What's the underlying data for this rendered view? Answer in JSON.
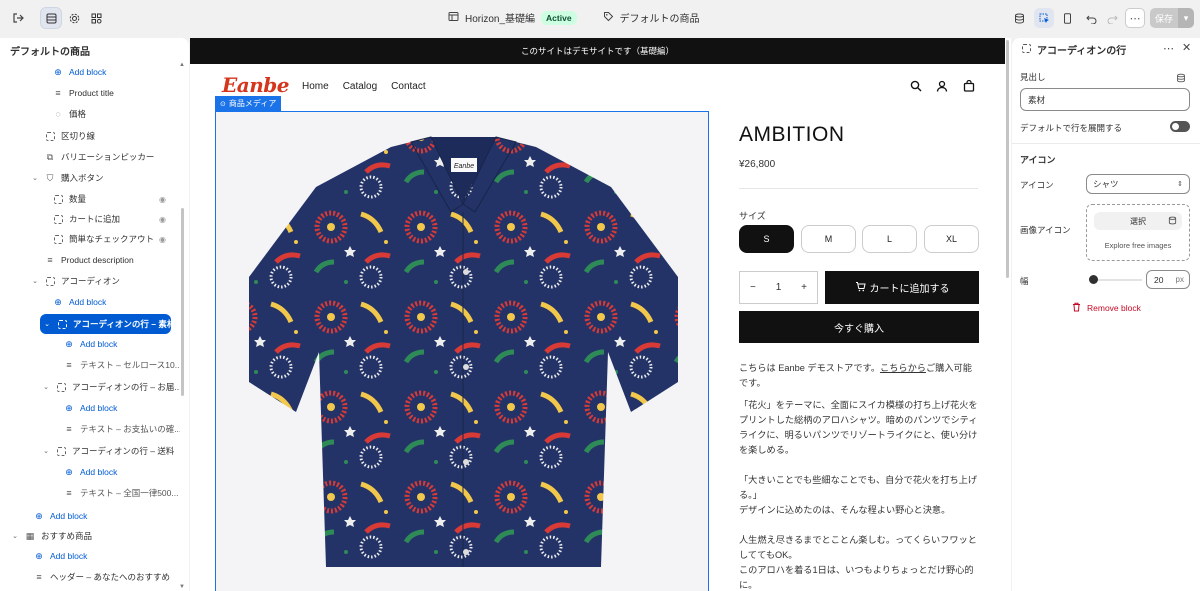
{
  "topbar": {
    "store_name": "Horizon_基礎編",
    "status": "Active",
    "template": "デフォルトの商品",
    "save": "保存"
  },
  "left": {
    "title": "デフォルトの商品",
    "rows": [
      {
        "label": "Add block",
        "type": "add"
      },
      {
        "label": "Product title",
        "type": "item"
      },
      {
        "label": "価格",
        "type": "item"
      },
      {
        "label": "区切り線",
        "type": "item"
      },
      {
        "label": "バリエーションピッカー",
        "type": "item"
      },
      {
        "label": "購入ボタン",
        "type": "group"
      },
      {
        "label": "数量",
        "type": "item"
      },
      {
        "label": "カートに追加",
        "type": "item"
      },
      {
        "label": "簡単なチェックアウト",
        "type": "item"
      },
      {
        "label": "Product description",
        "type": "item"
      },
      {
        "label": "アコーディオン",
        "type": "group"
      },
      {
        "label": "Add block",
        "type": "add"
      },
      {
        "label": "アコーディオンの行 – 素材",
        "type": "group"
      },
      {
        "label": "Add block",
        "type": "add"
      },
      {
        "label": "テキスト – セルロース10...",
        "type": "item"
      },
      {
        "label": "アコーディオンの行 – お届...",
        "type": "group"
      },
      {
        "label": "Add block",
        "type": "add"
      },
      {
        "label": "テキスト – お支払いの確...",
        "type": "item"
      },
      {
        "label": "アコーディオンの行 – 送料",
        "type": "group"
      },
      {
        "label": "Add block",
        "type": "add"
      },
      {
        "label": "テキスト – 全国一律500...",
        "type": "item"
      },
      {
        "label": "Add block",
        "type": "add"
      },
      {
        "label": "おすすめ商品",
        "type": "group"
      },
      {
        "label": "Add block",
        "type": "add"
      },
      {
        "label": "ヘッダー – あなたへのおすすめ",
        "type": "item"
      }
    ]
  },
  "preview": {
    "announcement": "このサイトはデモサイトです（基礎編）",
    "logo": "Eanbe",
    "nav": [
      "Home",
      "Catalog",
      "Contact"
    ],
    "media_tag": "商品メディア",
    "product_title": "AMBITION",
    "price": "¥26,800",
    "size_label": "サイズ",
    "sizes": [
      "S",
      "M",
      "L",
      "XL"
    ],
    "quantity": "1",
    "add_to_cart": "カートに追加する",
    "buy_now": "今すぐ購入",
    "desc_lead": "こちらは Eanbe デモストアです。",
    "desc_link": "こちらから",
    "desc_tail": "ご購入可能です。",
    "desc_p2": "「花火」をテーマに、全面にスイカ模様の打ち上げ花火をプリントした総柄のアロハシャツ。暗めのパンツでシティライクに、明るいパンツでリゾートライクにと、使い分けを楽しめる。",
    "desc_p3a": "「大きいことでも些細なことでも、自分で花火を打ち上げる。」",
    "desc_p3b": "デザインに込めたのは、そんな程よい野心と決意。",
    "desc_p4a": "人生燃え尽きるまでとことん楽しむ。ってくらいフワッとしててもOK。",
    "desc_p4b": "このアロハを着る1日は、いつもよりちょっとだけ野心的に。",
    "shirt_label": "Eanbe"
  },
  "right": {
    "title": "アコーディオンの行",
    "heading_label": "見出し",
    "heading_value": "素材",
    "expand_label": "デフォルトで行を展開する",
    "icon_section": "アイコン",
    "icon_label": "アイコン",
    "icon_value": "シャツ",
    "image_icon_label": "画像アイコン",
    "select_button": "選択",
    "explore": "Explore free images",
    "width_label": "幅",
    "width_value": "20",
    "width_unit": "px",
    "remove": "Remove block"
  },
  "colors": {
    "accent": "#005bd3",
    "badge_bg": "#cdfee1",
    "danger": "#c70a24"
  }
}
